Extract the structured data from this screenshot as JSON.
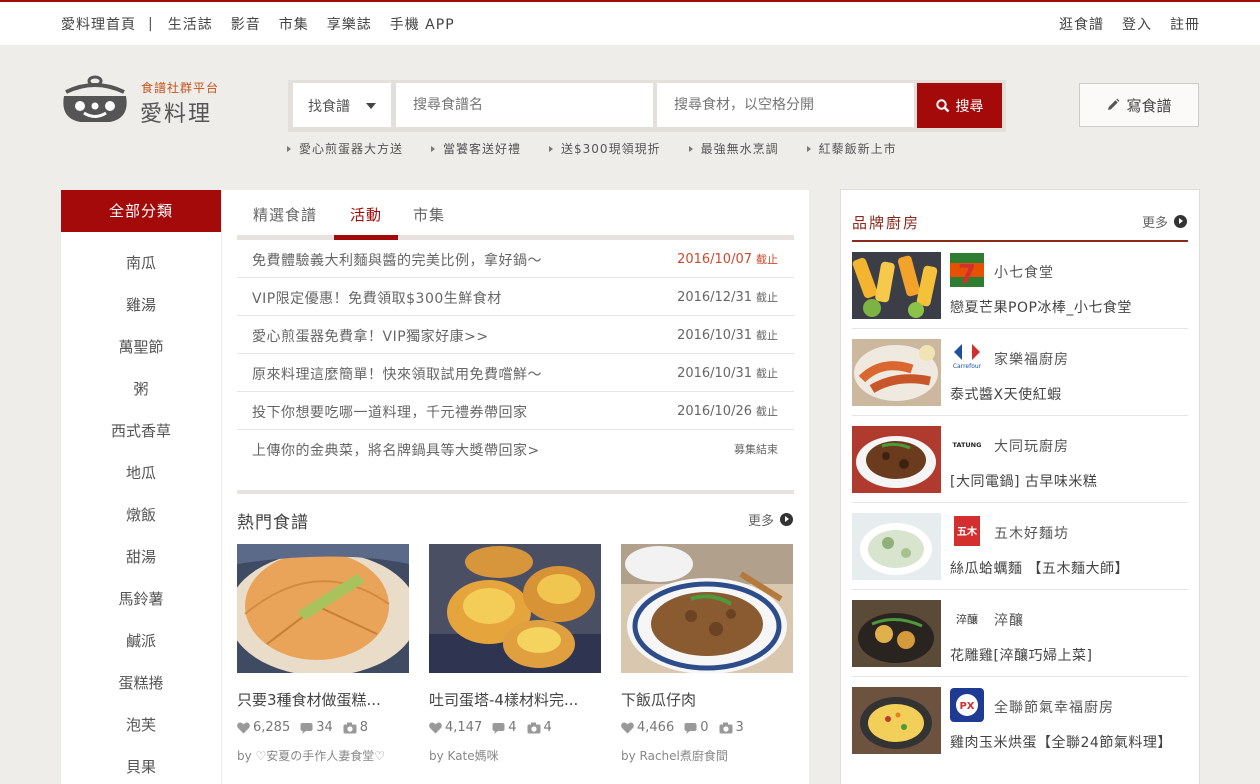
{
  "topnav": {
    "left": [
      "愛料理首頁",
      "生活誌",
      "影音",
      "市集",
      "享樂誌",
      "手機 APP"
    ],
    "separator": "|",
    "right": [
      "逛食譜",
      "登入",
      "註冊"
    ]
  },
  "logo": {
    "tagline": "食譜社群平台",
    "name": "愛料理"
  },
  "search": {
    "type_select": "找食譜",
    "recipe_placeholder": "搜尋食譜名",
    "ingredient_placeholder": "搜尋食材，以空格分開",
    "button": "搜尋"
  },
  "write_button": "寫食譜",
  "hotlinks": [
    "愛心煎蛋器大方送",
    "當饕客送好禮",
    "送$300現領現折",
    "最強無水烹調",
    "紅藜飯新上市"
  ],
  "categories": {
    "header": "全部分類",
    "items": [
      "南瓜",
      "雞湯",
      "萬聖節",
      "粥",
      "西式香草",
      "地瓜",
      "燉飯",
      "甜湯",
      "馬鈴薯",
      "鹹派",
      "蛋糕捲",
      "泡芙",
      "貝果"
    ]
  },
  "tabs": [
    "精選食譜",
    "活動",
    "市集"
  ],
  "events": [
    {
      "title": "免費體驗義大利麵與醬的完美比例，拿好鍋～",
      "date": "2016/10/07",
      "suffix": "截止"
    },
    {
      "title": "VIP限定優惠！免費領取$300生鮮食材",
      "date": "2016/12/31",
      "suffix": "截止"
    },
    {
      "title": "愛心煎蛋器免費拿！VIP獨家好康>>",
      "date": "2016/10/31",
      "suffix": "截止"
    },
    {
      "title": "原來料理這麼簡單！快來領取試用免費嚐鮮～",
      "date": "2016/10/31",
      "suffix": "截止"
    },
    {
      "title": "投下你想要吃哪一道料理，千元禮券帶回家",
      "date": "2016/10/26",
      "suffix": "截止"
    },
    {
      "title": "上傳你的金典菜，將名牌鍋具等大獎帶回家>",
      "date": "",
      "suffix": "募集結束"
    }
  ],
  "hot": {
    "title": "熱門食譜",
    "more": "更多",
    "cards": [
      {
        "title": "只要3種食材做蛋糕...",
        "likes": "6,285",
        "comments": "34",
        "photos": "8",
        "by": "by ♡安夏の手作人妻食堂♡"
      },
      {
        "title": "吐司蛋塔-4樣材料完...",
        "likes": "4,147",
        "comments": "4",
        "photos": "4",
        "by": "by Kate媽咪"
      },
      {
        "title": "下飯瓜仔肉",
        "likes": "4,466",
        "comments": "0",
        "photos": "3",
        "by": "by Rachel煮廚食間"
      }
    ]
  },
  "brands": {
    "title": "品牌廚房",
    "more": "更多",
    "items": [
      {
        "name": "小七食堂",
        "desc": "戀夏芒果POP冰棒_小七食堂",
        "logo_text": "7"
      },
      {
        "name": "家樂福廚房",
        "desc": "泰式醬X天使紅蝦",
        "logo_text": "Carrefour"
      },
      {
        "name": "大同玩廚房",
        "desc": "[大同電鍋] 古早味米糕",
        "logo_text": "TATUNG"
      },
      {
        "name": "五木好麵坊",
        "desc": "絲瓜蛤蠣麵 【五木麵大師】",
        "logo_text": "五木"
      },
      {
        "name": "淬釀",
        "desc": "花雕雞[淬釀巧婦上菜]",
        "logo_text": "淬釀"
      },
      {
        "name": "全聯節氣幸福廚房",
        "desc": "雞肉玉米烘蛋【全聯24節氣料理】",
        "logo_text": "PX"
      }
    ]
  },
  "colors": {
    "brand_red": "#a40a0a",
    "brown": "#8a2a1c",
    "bg": "#efedea"
  }
}
